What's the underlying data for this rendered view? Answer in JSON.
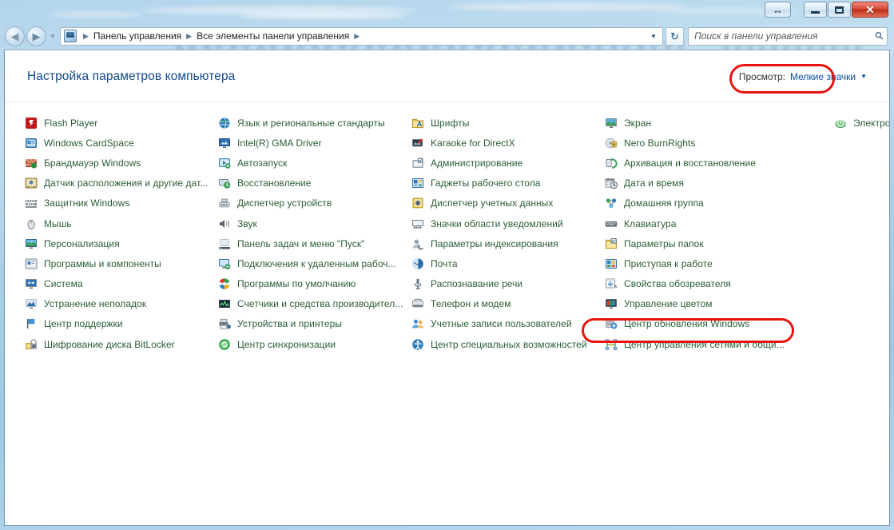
{
  "window": {
    "titlebar_buttons": [
      {
        "name": "resize-restore",
        "glyph": "↔"
      },
      {
        "name": "minimize",
        "glyph": ""
      },
      {
        "name": "maximize",
        "glyph": ""
      },
      {
        "name": "close",
        "glyph": "✕"
      }
    ]
  },
  "nav": {
    "back_glyph": "◀",
    "forward_glyph": "▶",
    "dropdown_glyph": "▼",
    "refresh_glyph": "↻",
    "breadcrumb": [
      "Панель управления",
      "Все элементы панели управления"
    ],
    "breadcrumb_separator": "▶",
    "address_dropdown_glyph": "▼"
  },
  "search": {
    "placeholder": "Поиск в панели управления",
    "value": "",
    "icon_glyph": "⚲"
  },
  "header": {
    "title": "Настройка параметров компьютера",
    "view_label": "Просмотр:",
    "view_value": "Мелкие значки",
    "view_caret": "▼"
  },
  "annotations": {
    "accent_color": "#e8130d",
    "highlighted_items": [
      "Мелкие значки",
      "Центр управления сетями и общи..."
    ]
  },
  "items": [
    {
      "label": "Flash Player",
      "icon": "flash-player-icon"
    },
    {
      "label": "Windows CardSpace",
      "icon": "cardspace-icon"
    },
    {
      "label": "Брандмауэр Windows",
      "icon": "firewall-icon"
    },
    {
      "label": "Датчик расположения и другие дат...",
      "icon": "location-sensor-icon"
    },
    {
      "label": "Защитник Windows",
      "icon": "defender-icon"
    },
    {
      "label": "Мышь",
      "icon": "mouse-icon"
    },
    {
      "label": "Персонализация",
      "icon": "personalization-icon"
    },
    {
      "label": "Программы и компоненты",
      "icon": "programs-features-icon"
    },
    {
      "label": "Система",
      "icon": "system-icon"
    },
    {
      "label": "Устранение неполадок",
      "icon": "troubleshooting-icon"
    },
    {
      "label": "Центр поддержки",
      "icon": "action-center-icon"
    },
    {
      "label": "Шифрование диска BitLocker",
      "icon": "bitlocker-icon"
    },
    {
      "label": "Язык и региональные стандарты",
      "icon": "region-language-icon"
    },
    {
      "label": "Intel(R) GMA Driver",
      "icon": "intel-gma-icon"
    },
    {
      "label": "Автозапуск",
      "icon": "autoplay-icon"
    },
    {
      "label": "Восстановление",
      "icon": "recovery-icon"
    },
    {
      "label": "Диспетчер устройств",
      "icon": "device-manager-icon"
    },
    {
      "label": "Звук",
      "icon": "sound-icon"
    },
    {
      "label": "Панель задач и меню \"Пуск\"",
      "icon": "taskbar-startmenu-icon"
    },
    {
      "label": "Подключения к удаленным рабоч...",
      "icon": "remote-connections-icon"
    },
    {
      "label": "Программы по умолчанию",
      "icon": "default-programs-icon"
    },
    {
      "label": "Счетчики и средства производител...",
      "icon": "performance-icon"
    },
    {
      "label": "Устройства и принтеры",
      "icon": "devices-printers-icon"
    },
    {
      "label": "Центр синхронизации",
      "icon": "sync-center-icon"
    },
    {
      "label": "Шрифты",
      "icon": "fonts-icon"
    },
    {
      "label": "Karaoke for DirectX",
      "icon": "karaoke-directx-icon"
    },
    {
      "label": "Администрирование",
      "icon": "administrative-tools-icon"
    },
    {
      "label": "Гаджеты рабочего стола",
      "icon": "desktop-gadgets-icon"
    },
    {
      "label": "Диспетчер учетных данных",
      "icon": "credential-manager-icon"
    },
    {
      "label": "Значки области уведомлений",
      "icon": "notification-icons-icon"
    },
    {
      "label": "Параметры индексирования",
      "icon": "indexing-options-icon"
    },
    {
      "label": "Почта",
      "icon": "mail-icon"
    },
    {
      "label": "Распознавание речи",
      "icon": "speech-recognition-icon"
    },
    {
      "label": "Телефон и модем",
      "icon": "phone-modem-icon"
    },
    {
      "label": "Учетные записи пользователей",
      "icon": "user-accounts-icon"
    },
    {
      "label": "Центр специальных возможностей",
      "icon": "ease-of-access-icon"
    },
    {
      "label": "Экран",
      "icon": "display-icon"
    },
    {
      "label": "Nero BurnRights",
      "icon": "nero-burnrights-icon"
    },
    {
      "label": "Архивация и восстановление",
      "icon": "backup-restore-icon"
    },
    {
      "label": "Дата и время",
      "icon": "date-time-icon"
    },
    {
      "label": "Домашняя группа",
      "icon": "homegroup-icon"
    },
    {
      "label": "Клавиатура",
      "icon": "keyboard-icon"
    },
    {
      "label": "Параметры папок",
      "icon": "folder-options-icon"
    },
    {
      "label": "Приступая к работе",
      "icon": "getting-started-icon"
    },
    {
      "label": "Свойства обозревателя",
      "icon": "internet-options-icon"
    },
    {
      "label": "Управление цветом",
      "icon": "color-management-icon"
    },
    {
      "label": "Центр обновления Windows",
      "icon": "windows-update-icon"
    },
    {
      "label": "Центр управления сетями и общи...",
      "icon": "network-sharing-center-icon"
    },
    {
      "label": "Электропитание",
      "icon": "power-options-icon"
    }
  ]
}
